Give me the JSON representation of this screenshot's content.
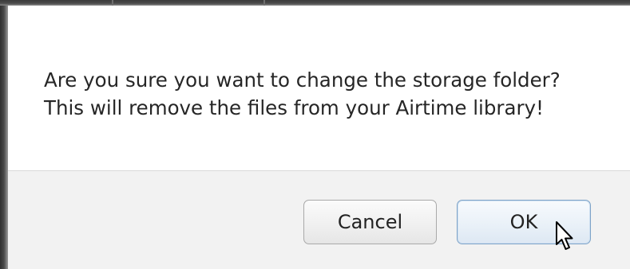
{
  "dialog": {
    "message_line_1": "Are you sure you want to change the storage folder?",
    "message_line_2": "This will remove the files from your Airtime library!",
    "buttons": {
      "cancel_label": "Cancel",
      "ok_label": "OK"
    },
    "focused_button": "OK"
  },
  "cursor": {
    "type": "arrow-pointer-icon"
  },
  "colors": {
    "body_background": "#ffffff",
    "button_pane_background": "#f2f2f2",
    "text": "#262626",
    "focused_button_border": "#7ea3c8"
  }
}
